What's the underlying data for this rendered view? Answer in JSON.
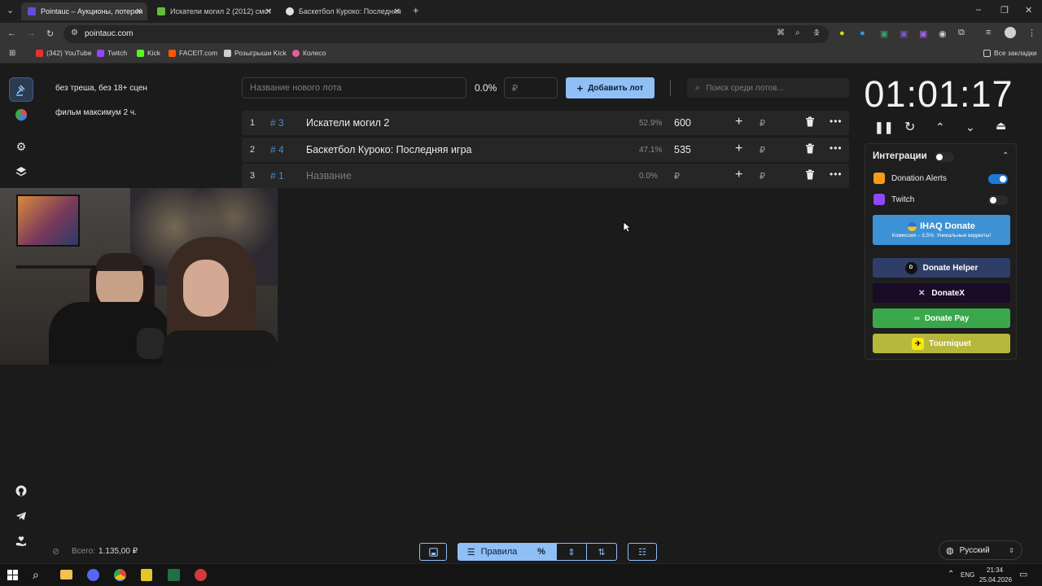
{
  "browser": {
    "tabs": [
      {
        "title": "Pointauc – Аукционы, лотереи",
        "active": true,
        "color": "#6a4bd6"
      },
      {
        "title": "Искатели могил 2 (2012) смот",
        "active": false,
        "color": "#5fbf3c"
      },
      {
        "title": "Баскетбол Куроко: Последняя",
        "active": false,
        "color": "#e0e0e0"
      }
    ],
    "url": "pointauc.com",
    "bookmarks": [
      {
        "label": "(342) YouTube",
        "color": "#e5322d"
      },
      {
        "label": "Twitch",
        "color": "#9146ff"
      },
      {
        "label": "Kick",
        "color": "#53fc18"
      },
      {
        "label": "FACEIT.com",
        "color": "#ff5500"
      },
      {
        "label": "Розыгрыши Kick",
        "color": "#cfcfcf"
      },
      {
        "label": "Колесо",
        "color": "#e65d9c"
      }
    ],
    "all_bookmarks": "Все закладки"
  },
  "rules": [
    "без треша, без 18+ сцен",
    "фильм максимум 2 ч."
  ],
  "new_lot": {
    "name_placeholder": "Название нового лота",
    "percent": "0.0%",
    "amount_placeholder": "₽",
    "add_label": "Добавить лот",
    "search_placeholder": "Поиск среди лотов..."
  },
  "lots": [
    {
      "num": "1",
      "id": "# 3",
      "name": "Искатели могил 2",
      "pct": "52.9%",
      "amount": "600",
      "rub": "₽"
    },
    {
      "num": "2",
      "id": "# 4",
      "name": "Баскетбол Куроко: Последняя игра",
      "pct": "47.1%",
      "amount": "535",
      "rub": "₽"
    },
    {
      "num": "3",
      "id": "# 1",
      "name": "Название",
      "pct": "0.0%",
      "amount": "₽",
      "rub": "₽"
    }
  ],
  "timer": "01:01:17",
  "integrations": {
    "title": "Интеграции",
    "donation_alerts": "Donation Alerts",
    "twitch": "Twitch",
    "ihaq": {
      "label": "IHAQ Donate",
      "sub": "Комиссия – 3,5%. Уникальные виджеты!"
    },
    "services": [
      {
        "label": "Donate Helper",
        "bg": "#2f3e67"
      },
      {
        "label": "DonateX",
        "bg": "#1a0b26"
      },
      {
        "label": "Donate Pay",
        "bg": "#3aa84a"
      },
      {
        "label": "Tourniquet",
        "bg": "#b5b83a"
      }
    ]
  },
  "footer": {
    "total_label": "Всего:",
    "total_value": "1.135,00 ₽",
    "rules_button": "Правила",
    "language": "Русский"
  },
  "taskbar": {
    "lang": "ENG",
    "time": "21:34",
    "date": "25.04.2026"
  }
}
